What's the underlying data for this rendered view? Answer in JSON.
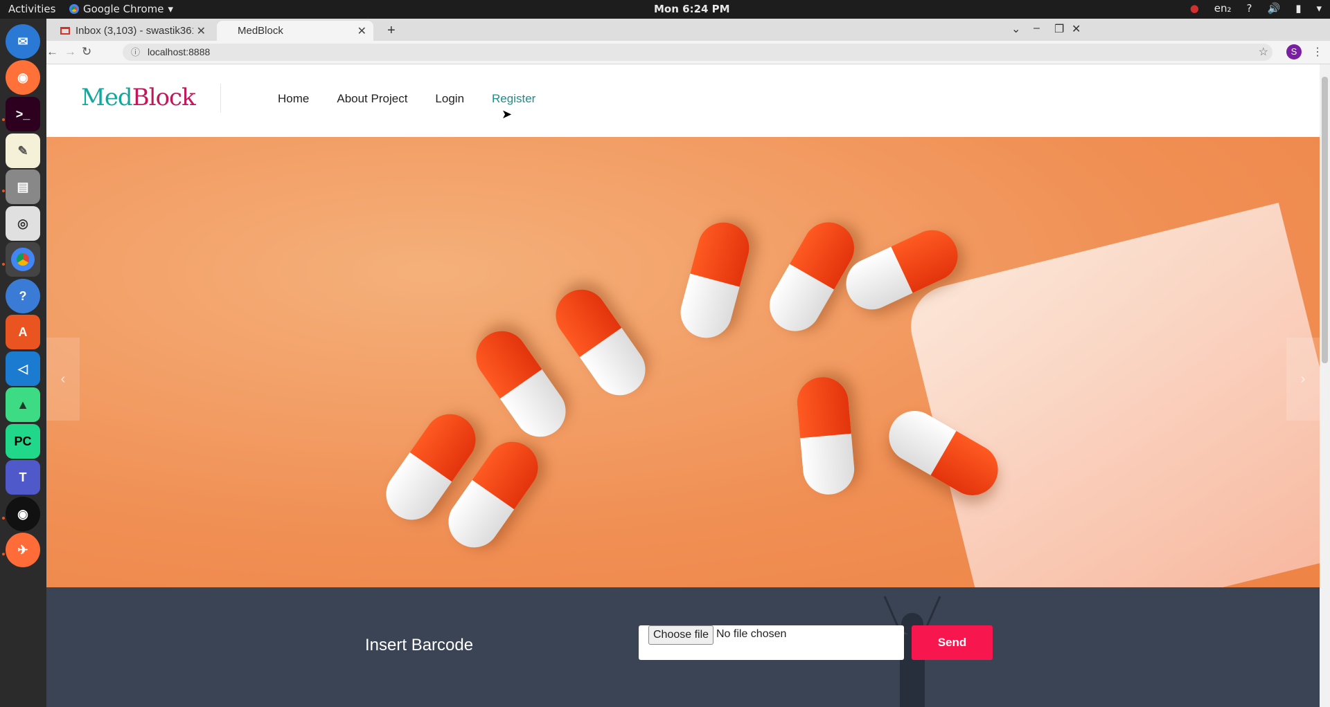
{
  "system": {
    "activities": "Activities",
    "app_name": "Google Chrome",
    "clock": "Mon  6:24 PM",
    "keyboard_layout": "en₂"
  },
  "browser": {
    "tabs": [
      {
        "title": "Inbox (3,103) - swastik361",
        "icon": "gmail-icon",
        "active": false
      },
      {
        "title": "MedBlock",
        "icon": "page-icon",
        "active": true
      }
    ],
    "url": "localhost:8888",
    "profile_initial": "S"
  },
  "page": {
    "logo_part1": "Med",
    "logo_part2": "Block",
    "nav": [
      {
        "label": "Home",
        "active": false
      },
      {
        "label": "About Project",
        "active": false
      },
      {
        "label": "Login",
        "active": false
      },
      {
        "label": "Register",
        "active": true
      }
    ],
    "barcode": {
      "label": "Insert Barcode",
      "file_button": "Choose file",
      "file_status": "No file chosen",
      "send": "Send"
    }
  },
  "colors": {
    "accent_teal": "#13a89e",
    "accent_pink": "#c2185b",
    "send_button": "#f7164d",
    "section_bg": "#3b4455"
  }
}
